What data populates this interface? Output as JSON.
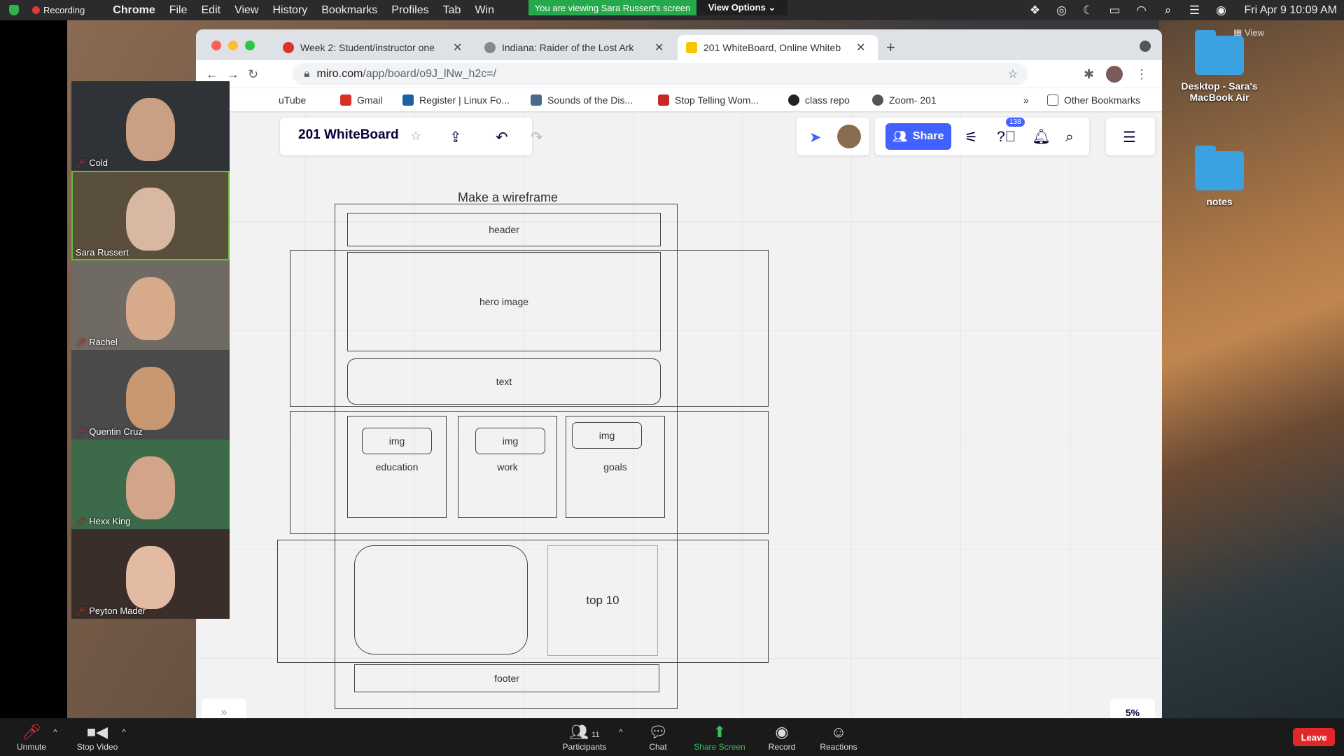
{
  "menubar": {
    "recording": "Recording",
    "app": "Chrome",
    "items": [
      "File",
      "Edit",
      "View",
      "History",
      "Bookmarks",
      "Profiles",
      "Tab",
      "Win"
    ],
    "viewing_banner": "You are viewing Sara Russert's screen",
    "view_options": "View Options ⌄",
    "clock": "Fri Apr 9  10:09 AM"
  },
  "desktop": {
    "view_label": "View",
    "icons": [
      {
        "label": "Desktop - Sara's MacBook Air"
      },
      {
        "label": "notes"
      }
    ]
  },
  "chrome": {
    "tabs": [
      {
        "title": "Week 2: Student/instructor one",
        "fav_color": "#d9342b"
      },
      {
        "title": "Indiana: Raider of the Lost Ark",
        "fav_color": "#888888"
      },
      {
        "title": "201 WhiteBoard, Online Whiteb",
        "fav_color": "#f7c600"
      }
    ],
    "url_host": "miro.com",
    "url_path": "/app/board/o9J_lNw_h2c=/",
    "bookmarks": [
      {
        "label": "uTube",
        "color": "#ffffff"
      },
      {
        "label": "Gmail",
        "color": "#d93025"
      },
      {
        "label": "Register | Linux Fo...",
        "color": "#1f5fa6"
      },
      {
        "label": "Sounds of the Dis...",
        "color": "#4a6a8a"
      },
      {
        "label": "Stop Telling Wom...",
        "color": "#c62828"
      },
      {
        "label": "class repo",
        "color": "#222222"
      },
      {
        "label": "Zoom- 201",
        "color": "#555555"
      }
    ],
    "more_bookmarks": "»",
    "other_bookmarks": "Other Bookmarks"
  },
  "miro": {
    "board_title": "201 WhiteBoard",
    "share_label": "Share",
    "notification_count": "138",
    "zoom": "5%",
    "expand": "»",
    "frame_title": "Make a wireframe",
    "wireframe": {
      "header": "header",
      "hero": "hero image",
      "text": "text",
      "cards": [
        {
          "img": "img",
          "label": "education"
        },
        {
          "img": "img",
          "label": "work"
        },
        {
          "img": "img",
          "label": "goals"
        }
      ],
      "top10": "top 10",
      "footer": "footer"
    }
  },
  "participants": [
    {
      "name": "Cold",
      "muted": true,
      "bg": "#2f3338",
      "skin": "#c9a083"
    },
    {
      "name": "Sara Russert",
      "muted": false,
      "bg": "#5a4f3c",
      "skin": "#d9b8a3"
    },
    {
      "name": "Rachel",
      "muted": true,
      "bg": "#6f6a63",
      "skin": "#d8aa8c"
    },
    {
      "name": "Quentin Cruz",
      "muted": true,
      "bg": "#4a4a4a",
      "skin": "#c79872"
    },
    {
      "name": "Hexx King",
      "muted": true,
      "bg": "#3d6b4a",
      "skin": "#d2a58a"
    },
    {
      "name": "Peyton Mader",
      "muted": true,
      "bg": "#3a2e2a",
      "skin": "#e2bba2"
    }
  ],
  "zoom_toolbar": {
    "unmute": "Unmute",
    "stop_video": "Stop Video",
    "participants": "Participants",
    "participant_count": "11",
    "chat": "Chat",
    "share_screen": "Share Screen",
    "record": "Record",
    "reactions": "Reactions",
    "leave": "Leave"
  }
}
